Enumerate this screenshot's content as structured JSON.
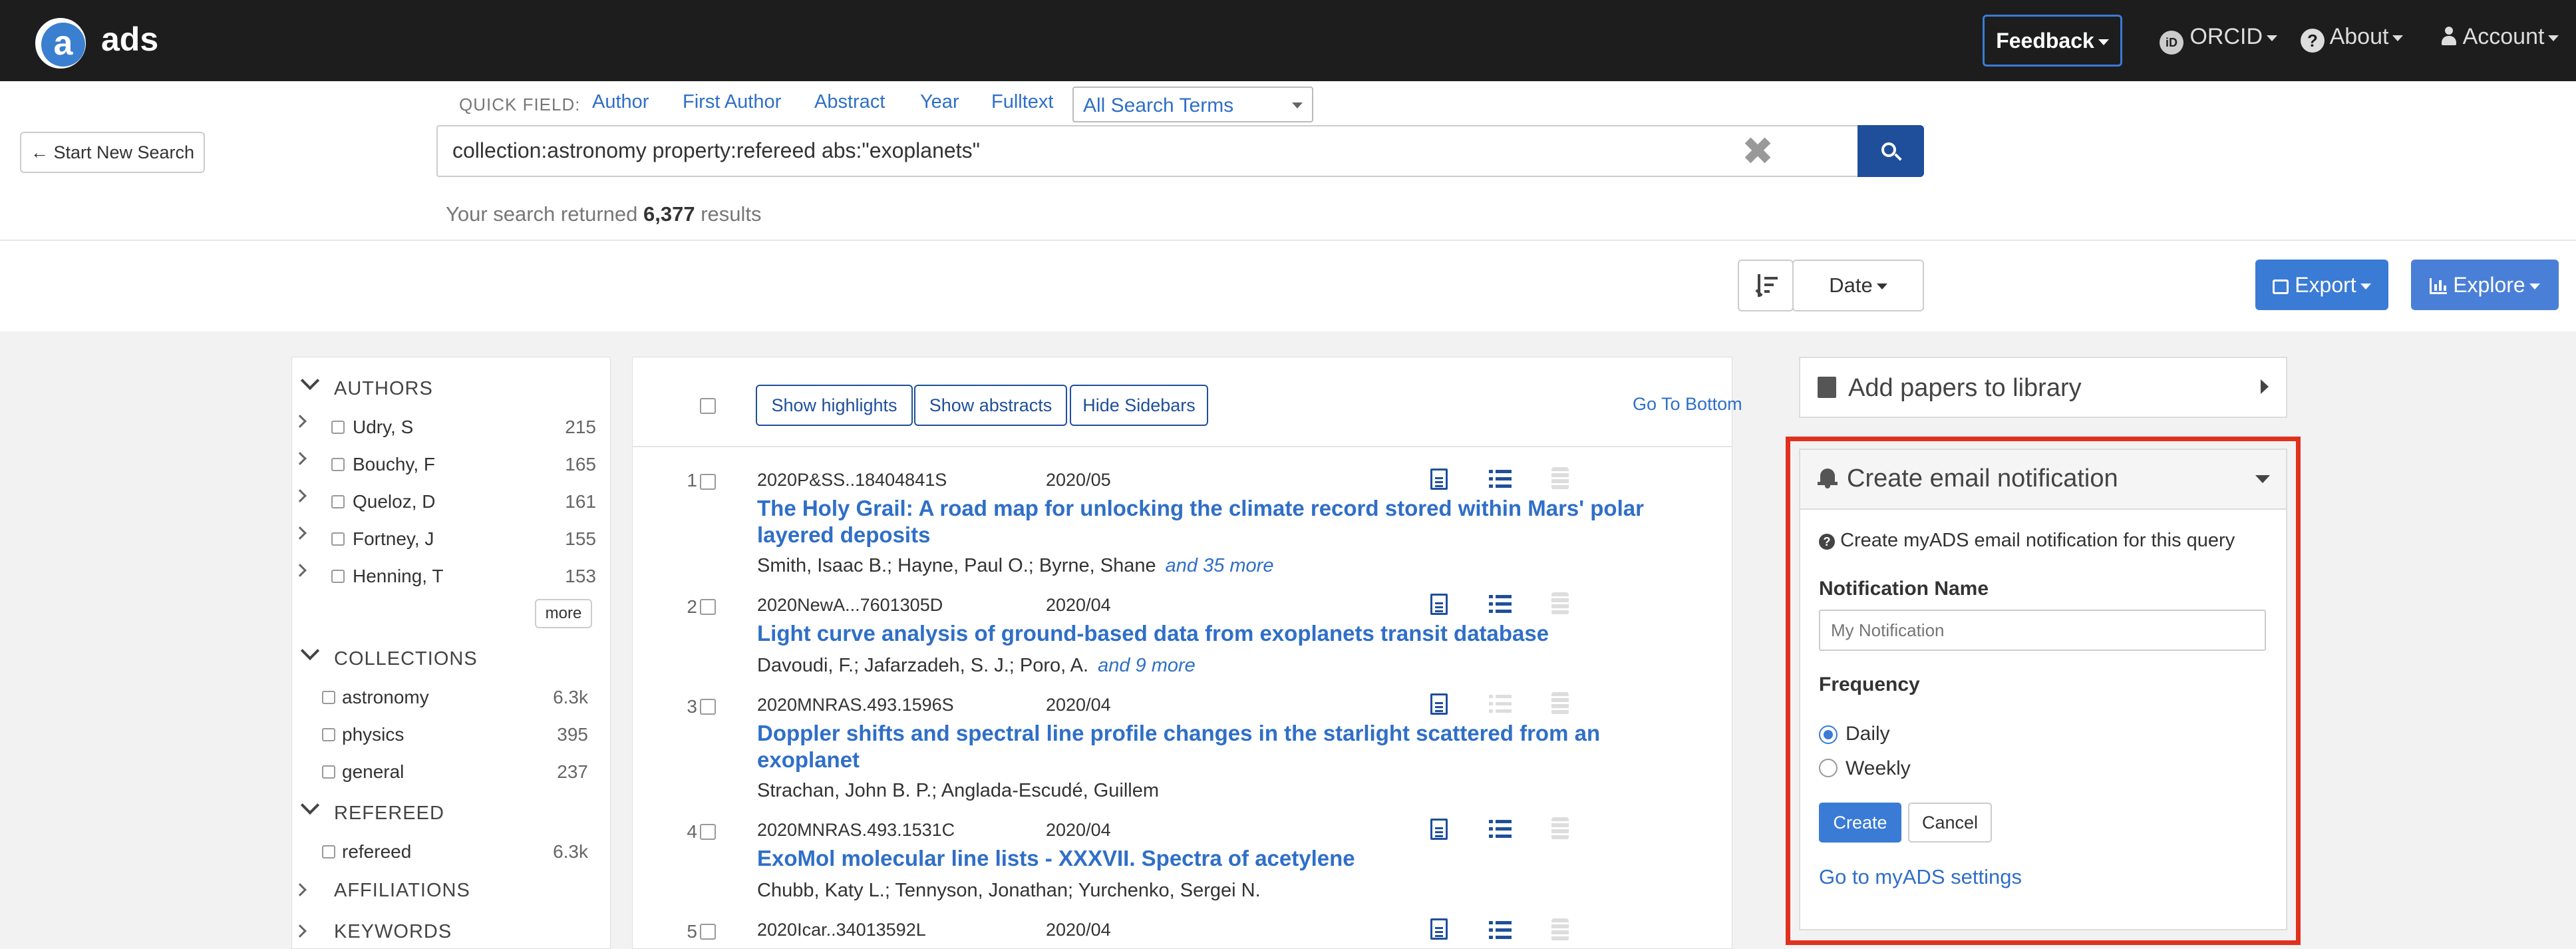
{
  "nav": {
    "logo_letter": "a",
    "brand": "ads",
    "feedback": "Feedback",
    "orcid": "ORCID",
    "about": "About",
    "account": "Account"
  },
  "search": {
    "start_new": "Start New Search",
    "quick_field_label": "QUICK FIELD:",
    "quick_fields": [
      "Author",
      "First Author",
      "Abstract",
      "Year",
      "Fulltext"
    ],
    "all_terms": "All Search Terms",
    "query": "collection:astronomy property:refereed abs:\"exoplanets\"",
    "results_prefix": "Your search returned",
    "results_count": "6,377",
    "results_suffix": "results"
  },
  "sort": {
    "date_label": "Date",
    "export_label": "Export",
    "explore_label": "Explore"
  },
  "facets": {
    "authors_title": "AUTHORS",
    "authors": [
      {
        "name": "Udry, S",
        "count": "215"
      },
      {
        "name": "Bouchy, F",
        "count": "165"
      },
      {
        "name": "Queloz, D",
        "count": "161"
      },
      {
        "name": "Fortney, J",
        "count": "155"
      },
      {
        "name": "Henning, T",
        "count": "153"
      }
    ],
    "more_label": "more",
    "collections_title": "COLLECTIONS",
    "collections": [
      {
        "name": "astronomy",
        "count": "6.3k"
      },
      {
        "name": "physics",
        "count": "395"
      },
      {
        "name": "general",
        "count": "237"
      }
    ],
    "refereed_title": "REFEREED",
    "refereed": [
      {
        "name": "refereed",
        "count": "6.3k"
      }
    ],
    "affiliations_title": "AFFILIATIONS",
    "keywords_title": "KEYWORDS"
  },
  "results": {
    "show_highlights": "Show highlights",
    "show_abstracts": "Show abstracts",
    "hide_sidebars": "Hide Sidebars",
    "go_bottom": "Go To Bottom",
    "items": [
      {
        "num": "1",
        "bibcode": "2020P&SS..18404841S",
        "date": "2020/05",
        "title_line1": "The Holy Grail: A road map for unlocking the climate record stored within Mars' polar",
        "title_line2": "layered deposits",
        "authors": "Smith, Isaac B.;  Hayne, Paul O.;  Byrne, Shane",
        "more": "and 35 more"
      },
      {
        "num": "2",
        "bibcode": "2020NewA...7601305D",
        "date": "2020/04",
        "title_line1": "Light curve analysis of ground-based data from exoplanets transit database",
        "title_line2": "",
        "authors": "Davoudi, F.;  Jafarzadeh, S. J.;  Poro, A.",
        "more": "and 9 more"
      },
      {
        "num": "3",
        "bibcode": "2020MNRAS.493.1596S",
        "date": "2020/04",
        "title_line1": "Doppler shifts and spectral line profile changes in the starlight scattered from an",
        "title_line2": "exoplanet",
        "authors": "Strachan, John B. P.;  Anglada-Escudé, Guillem",
        "more": ""
      },
      {
        "num": "4",
        "bibcode": "2020MNRAS.493.1531C",
        "date": "2020/04",
        "title_line1": "ExoMol molecular line lists - XXXVII. Spectra of acetylene",
        "title_line2": "",
        "authors": "Chubb, Katy L.;  Tennyson, Jonathan;  Yurchenko, Sergei N.",
        "more": ""
      },
      {
        "num": "5",
        "bibcode": "2020Icar..34013592L",
        "date": "2020/04",
        "title_line1": "",
        "title_line2": "",
        "authors": "",
        "more": ""
      }
    ]
  },
  "library": {
    "title": "Add papers to library"
  },
  "notification": {
    "title": "Create email notification",
    "help": "Create myADS email notification for this query",
    "name_label": "Notification Name",
    "name_placeholder": "My Notification",
    "frequency_label": "Frequency",
    "daily": "Daily",
    "weekly": "Weekly",
    "frequency_selected": "Daily",
    "create": "Create",
    "cancel": "Cancel",
    "settings_link": "Go to myADS settings"
  },
  "colors": {
    "accent": "#2f6fc7",
    "dark_blue": "#1f4f9a",
    "highlight": "#e0311e",
    "topbar": "#1d1d1d"
  }
}
